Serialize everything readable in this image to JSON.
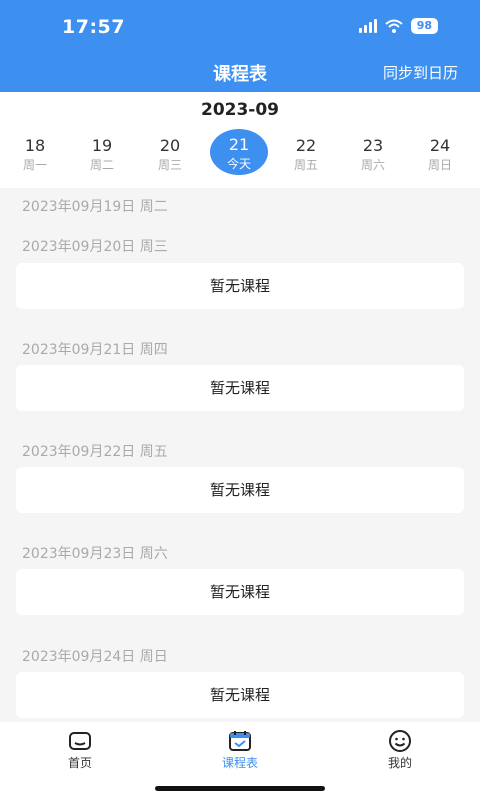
{
  "status": {
    "time": "17:57",
    "battery": "98"
  },
  "header": {
    "title": "课程表",
    "sync_label": "同步到日历"
  },
  "calendar": {
    "month": "2023-09",
    "days": [
      {
        "num": "18",
        "label": "周一"
      },
      {
        "num": "19",
        "label": "周二"
      },
      {
        "num": "20",
        "label": "周三"
      },
      {
        "num": "21",
        "label": "今天"
      },
      {
        "num": "22",
        "label": "周五"
      },
      {
        "num": "23",
        "label": "周六"
      },
      {
        "num": "24",
        "label": "周日"
      }
    ],
    "selected_index": 3
  },
  "schedule": [
    {
      "date": "2023年09月19日  周二"
    },
    {
      "date": "2023年09月20日  周三",
      "empty_text": "暂无课程"
    },
    {
      "date": "2023年09月21日  周四",
      "empty_text": "暂无课程"
    },
    {
      "date": "2023年09月22日  周五",
      "empty_text": "暂无课程"
    },
    {
      "date": "2023年09月23日  周六",
      "empty_text": "暂无课程"
    },
    {
      "date": "2023年09月24日  周日",
      "empty_text": "暂无课程"
    }
  ],
  "tabbar": {
    "items": [
      {
        "label": "首页",
        "icon": "home-icon"
      },
      {
        "label": "课程表",
        "icon": "calendar-icon"
      },
      {
        "label": "我的",
        "icon": "smile-icon"
      }
    ],
    "active_index": 1
  },
  "colors": {
    "accent": "#3d8ff0"
  }
}
